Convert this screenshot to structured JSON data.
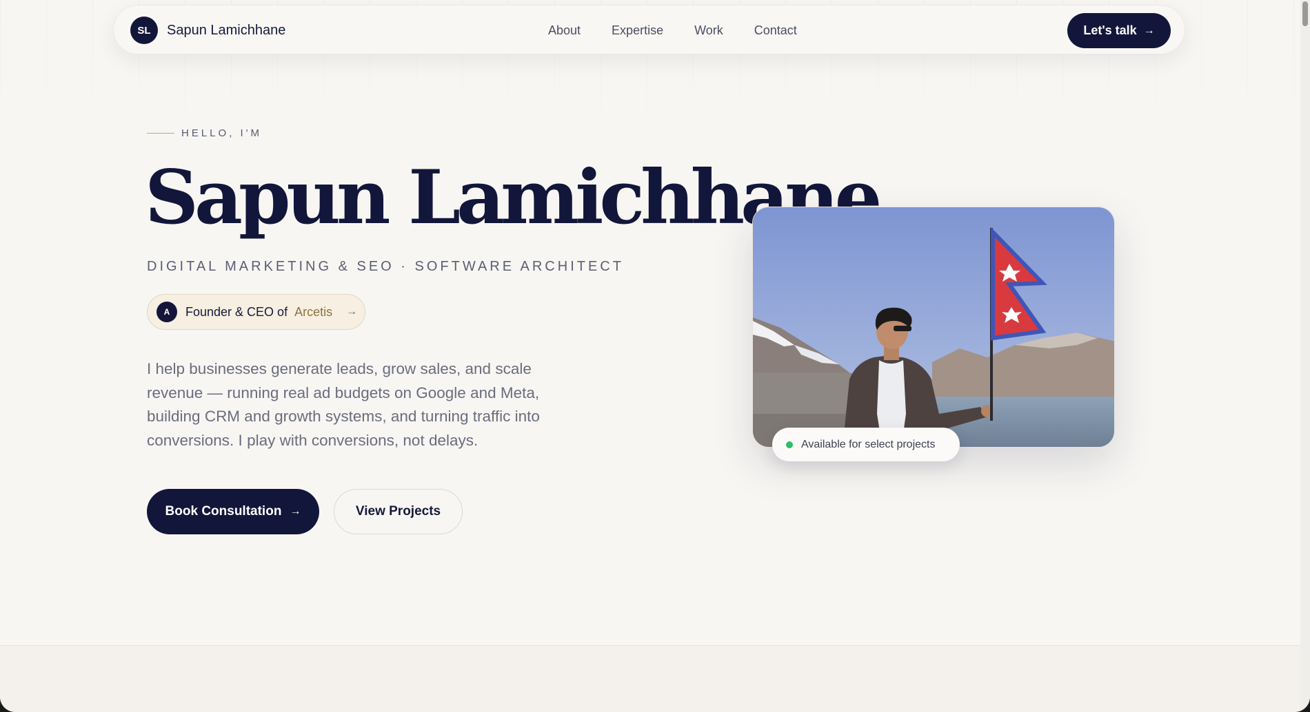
{
  "nav": {
    "brand_initials": "SL",
    "brand_name": "Sapun Lamichhane",
    "links": [
      "About",
      "Expertise",
      "Work",
      "Contact"
    ],
    "cta_label": "Let's talk",
    "cta_icon": "arrow-right-icon"
  },
  "hero": {
    "eyebrow": "HELLO, I'M",
    "name": "Sapun Lamichhane",
    "role": "DIGITAL MARKETING & SEO · SOFTWARE ARCHITECT",
    "founder": {
      "initial": "A",
      "label": "Founder & CEO of",
      "company": "Arcetis",
      "icon": "arrow-right-icon"
    },
    "description": "I help businesses generate leads, grow sales, and scale revenue — running real ad budgets on Google and Meta, building CRM and growth systems, and turning traffic into conversions. I play with conversions, not delays.",
    "primary_button": "Book Consultation",
    "secondary_button": "View Projects"
  },
  "photo": {
    "status_text": "Available for select projects",
    "status_color": "#2ebd6b"
  },
  "colors": {
    "accent": "#12163a",
    "background": "#f8f6f3",
    "gold": "#8a7340"
  }
}
